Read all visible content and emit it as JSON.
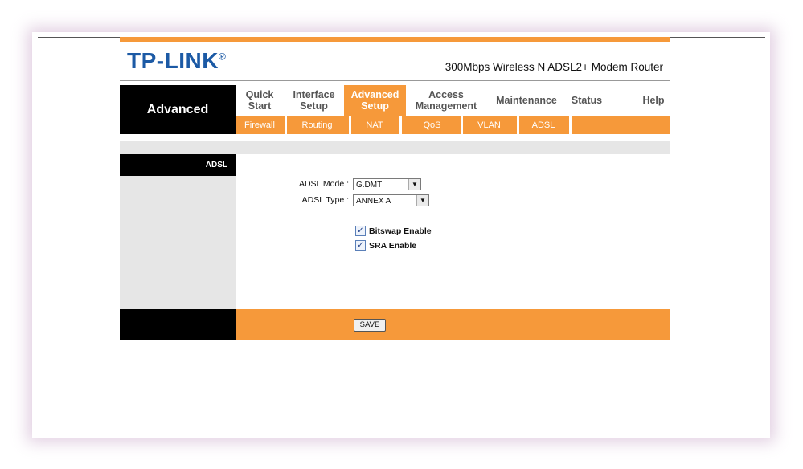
{
  "brand": {
    "logo_text": "TP-LINK",
    "logo_mark": "®",
    "product": "300Mbps Wireless N ADSL2+ Modem Router"
  },
  "section_title": "Advanced",
  "nav": [
    {
      "line1": "Quick",
      "line2": "Start"
    },
    {
      "line1": "Interface",
      "line2": "Setup"
    },
    {
      "line1": "Advanced",
      "line2": "Setup",
      "active": true
    },
    {
      "line1": "Access",
      "line2": "Management"
    },
    {
      "line1": "Maintenance",
      "line2": ""
    },
    {
      "line1": "Status",
      "line2": ""
    },
    {
      "line1": "Help",
      "line2": ""
    }
  ],
  "subnav": [
    "Firewall",
    "Routing",
    "NAT",
    "QoS",
    "VLAN",
    "ADSL"
  ],
  "sidebar": {
    "heading": "ADSL"
  },
  "form": {
    "adsl_mode": {
      "label": "ADSL Mode :",
      "value": "G.DMT"
    },
    "adsl_type": {
      "label": "ADSL Type :",
      "value": "ANNEX A"
    },
    "bitswap": {
      "label": "Bitswap Enable",
      "checked": true
    },
    "sra": {
      "label": "SRA Enable",
      "checked": true
    }
  },
  "save_label": "SAVE",
  "colors": {
    "accent": "#f6993a",
    "brand_blue": "#1c5aa5",
    "black": "#000000",
    "panel_grey": "#e6e6e6"
  }
}
